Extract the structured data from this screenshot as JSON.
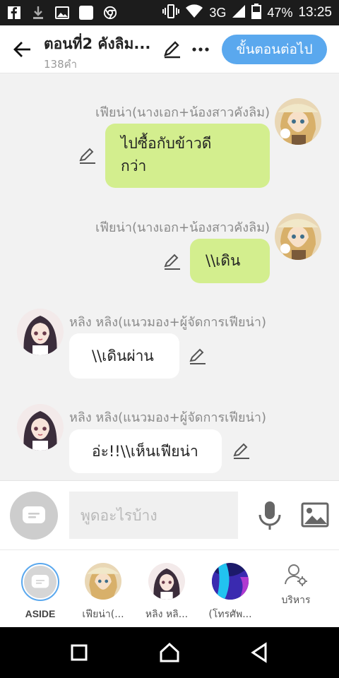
{
  "status_bar": {
    "battery": "47%",
    "network": "3G",
    "time": "13:25"
  },
  "header": {
    "title": "ตอนที่2 คังลิม...",
    "word_count": "138คำ",
    "next_label": "ขั้นตอนต่อไป"
  },
  "messages": [
    {
      "speaker": "เฟียน่า(นางเอก+น้องสาวคังลิม)",
      "lines": [
        "ไปซื้อกับข้าวดี",
        "กว่า"
      ],
      "side": "right"
    },
    {
      "speaker": "เฟียน่า(นางเอก+น้องสาวคังลิม)",
      "lines": [
        "\\\\เดิน"
      ],
      "side": "right"
    },
    {
      "speaker": "หลิง หลิง(แนวมอง+ผู้จัดการเฟียน่า)",
      "lines": [
        "\\\\เดินผ่าน"
      ],
      "side": "left"
    },
    {
      "speaker": "หลิง หลิง(แนวมอง+ผู้จัดการเฟียน่า)",
      "lines": [
        "อ่ะ!!\\\\เห็นเฟียน่า"
      ],
      "side": "left"
    }
  ],
  "input": {
    "placeholder": "พูดอะไรบ้าง"
  },
  "characters": [
    {
      "label": "ASIDE"
    },
    {
      "label": "เฟียน่า(..."
    },
    {
      "label": "หลิง หลิ..."
    },
    {
      "label": "(โทรศัพ..."
    },
    {
      "label": "บริหาร"
    }
  ],
  "colors": {
    "accent": "#5aa8ee",
    "bubble_green": "#d3ee8e",
    "bubble_white": "#ffffff"
  }
}
